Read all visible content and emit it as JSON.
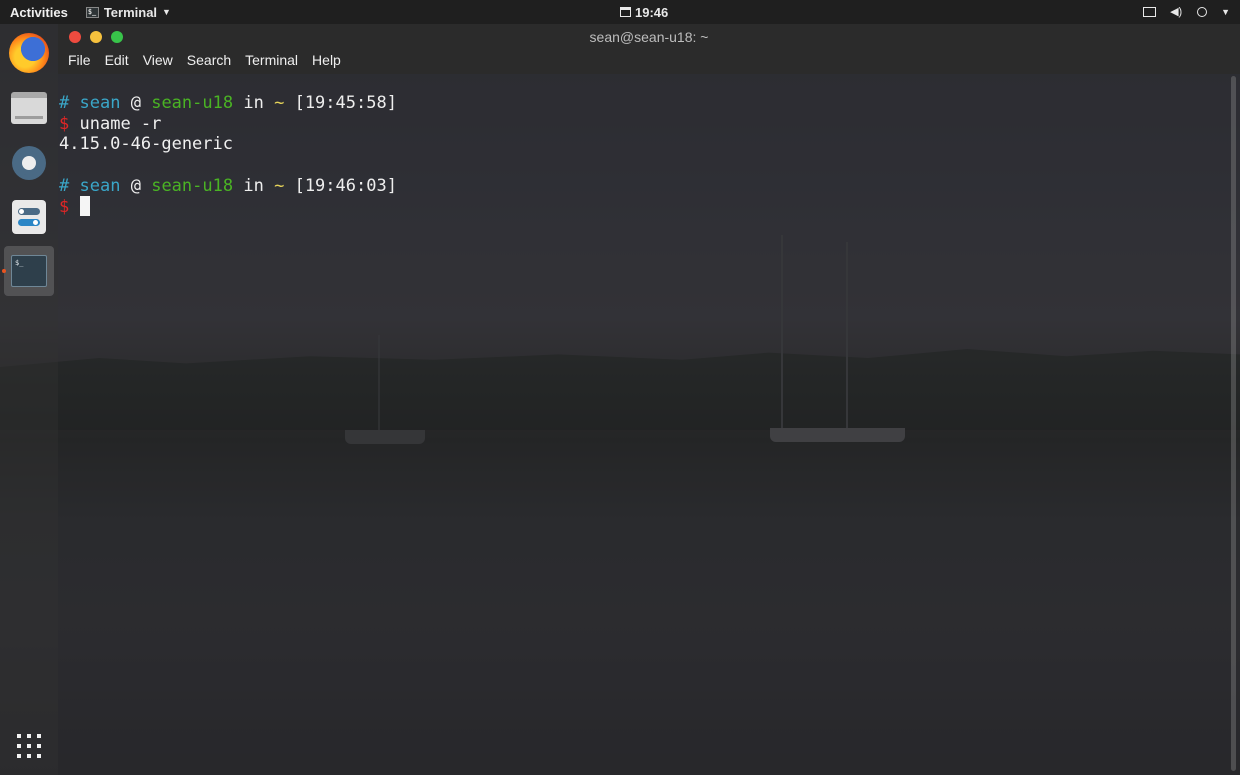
{
  "topbar": {
    "activities": "Activities",
    "app_name": "Terminal",
    "clock": "19:46"
  },
  "dock": {
    "items": [
      "firefox",
      "files",
      "settings",
      "tweaks",
      "terminal"
    ],
    "active": "terminal"
  },
  "window": {
    "title": "sean@sean-u18: ~",
    "menu": [
      "File",
      "Edit",
      "View",
      "Search",
      "Terminal",
      "Help"
    ]
  },
  "terminal": {
    "prompt1": {
      "hash": "#",
      "user": "sean",
      "at": "@",
      "host": "sean-u18",
      "in": "in",
      "dir": "~",
      "time": "[19:45:58]"
    },
    "cmd1": {
      "dollar": "$",
      "command": "uname -r"
    },
    "output1": "4.15.0-46-generic",
    "prompt2": {
      "hash": "#",
      "user": "sean",
      "at": "@",
      "host": "sean-u18",
      "in": "in",
      "dir": "~",
      "time": "[19:46:03]"
    },
    "cmd2": {
      "dollar": "$"
    }
  },
  "colors": {
    "prompt_user": "#3aa6c8",
    "prompt_host": "#4ab324",
    "prompt_dir": "#e6d45a",
    "prompt_dollar": "#e02626",
    "close": "#ee4b3f",
    "minimize": "#f6c13d",
    "maximize": "#38c44a"
  }
}
